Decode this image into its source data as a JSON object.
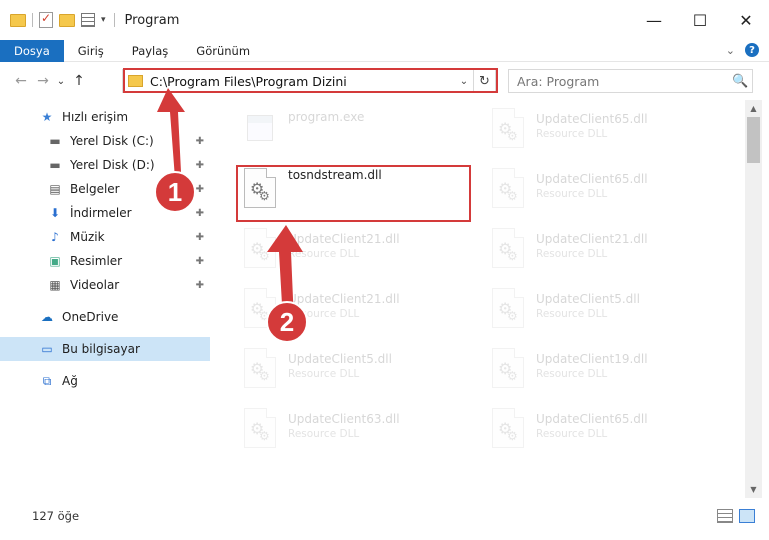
{
  "window": {
    "title": "Program",
    "minimize": "—",
    "maximize": "☐",
    "close": "✕"
  },
  "ribbon": {
    "tabs": [
      "Dosya",
      "Giriş",
      "Paylaş",
      "Görünüm"
    ],
    "expand": "⌄",
    "help": "?"
  },
  "nav": {
    "back": "←",
    "forward": "→",
    "recent": "⌄",
    "up": "↑"
  },
  "address": {
    "path": "C:\\Program Files\\Program Dizini",
    "dropdown": "⌄",
    "refresh": "↻"
  },
  "search": {
    "placeholder": "Ara: Program",
    "icon": "🔍"
  },
  "sidebar": {
    "items": [
      {
        "label": "Hızlı erişim",
        "icon": "star-icon",
        "glyph": "★"
      },
      {
        "label": "Yerel Disk (C:)",
        "icon": "drive-icon",
        "glyph": "▬",
        "pinned": true
      },
      {
        "label": "Yerel Disk (D:)",
        "icon": "drive-icon",
        "glyph": "▬",
        "pinned": true
      },
      {
        "label": "Belgeler",
        "icon": "documents-icon",
        "glyph": "▤",
        "pinned": true
      },
      {
        "label": "İndirmeler",
        "icon": "download-icon",
        "glyph": "⬇",
        "pinned": true
      },
      {
        "label": "Müzik",
        "icon": "music-icon",
        "glyph": "♪",
        "pinned": true
      },
      {
        "label": "Resimler",
        "icon": "pictures-icon",
        "glyph": "▣",
        "pinned": true
      },
      {
        "label": "Videolar",
        "icon": "videos-icon",
        "glyph": "▦",
        "pinned": true
      },
      {
        "label": "OneDrive",
        "icon": "cloud-icon",
        "glyph": "☁"
      },
      {
        "label": "Bu bilgisayar",
        "icon": "computer-icon",
        "glyph": "▭",
        "selected": true
      },
      {
        "label": "Ağ",
        "icon": "network-icon",
        "glyph": "⧉"
      }
    ],
    "pin_glyph": "📌"
  },
  "files": [
    {
      "name": "program.exe",
      "type": "",
      "faded": true,
      "kind": "exe"
    },
    {
      "name": "tosndstream.dll",
      "type": "",
      "faded": false,
      "kind": "dll",
      "highlighted": true
    },
    {
      "name": "UpdateClient21.dll",
      "type": "Resource DLL",
      "faded": true,
      "kind": "dll"
    },
    {
      "name": "UpdateClient21.dll",
      "type": "Resource DLL",
      "faded": true,
      "kind": "dll"
    },
    {
      "name": "UpdateClient5.dll",
      "type": "Resource DLL",
      "faded": true,
      "kind": "dll"
    },
    {
      "name": "UpdateClient63.dll",
      "type": "Resource DLL",
      "faded": true,
      "kind": "dll"
    },
    {
      "name": "UpdateClient65.dll",
      "type": "Resource DLL",
      "faded": true,
      "kind": "dll"
    },
    {
      "name": "UpdateClient65.dll",
      "type": "Resource DLL",
      "faded": true,
      "kind": "dll"
    },
    {
      "name": "UpdateClient21.dll",
      "type": "Resource DLL",
      "faded": true,
      "kind": "dll"
    },
    {
      "name": "UpdateClient5.dll",
      "type": "Resource DLL",
      "faded": true,
      "kind": "dll"
    },
    {
      "name": "UpdateClient19.dll",
      "type": "Resource DLL",
      "faded": true,
      "kind": "dll"
    },
    {
      "name": "UpdateClient65.dll",
      "type": "Resource DLL",
      "faded": true,
      "kind": "dll"
    }
  ],
  "status": {
    "count": "127 öğe"
  },
  "annotations": {
    "step1": "1",
    "step2": "2",
    "color": "#d43a3a"
  }
}
